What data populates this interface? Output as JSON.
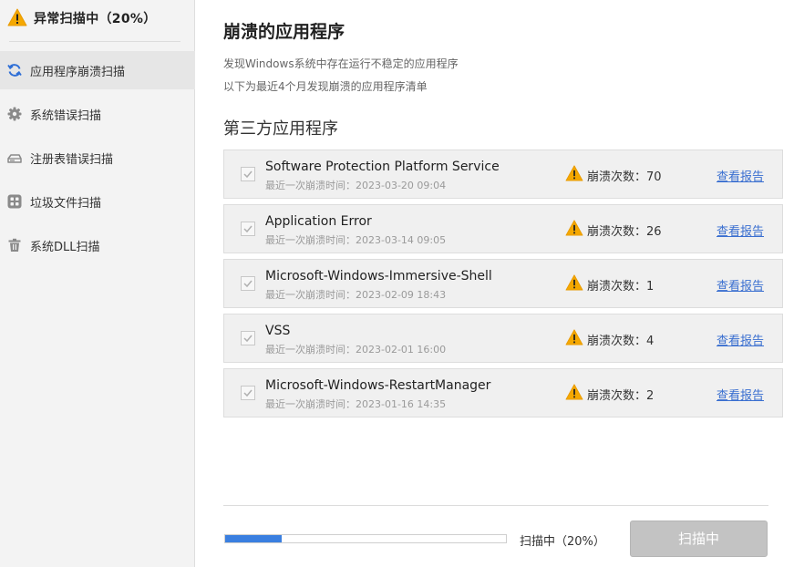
{
  "sidebar": {
    "header": {
      "title": "异常扫描中（20%）",
      "icon": "warning-icon"
    },
    "items": [
      {
        "label": "应用程序崩溃扫描",
        "icon": "refresh-icon",
        "active": true
      },
      {
        "label": "系统错误扫描",
        "icon": "gear-icon",
        "active": false
      },
      {
        "label": "注册表错误扫描",
        "icon": "registry-icon",
        "active": false
      },
      {
        "label": "垃圾文件扫描",
        "icon": "grid-icon",
        "active": false
      },
      {
        "label": "系统DLL扫描",
        "icon": "trash-icon",
        "active": false
      }
    ]
  },
  "main": {
    "title": "崩溃的应用程序",
    "desc1": "发现Windows系统中存在运行不稳定的应用程序",
    "desc2": "以下为最近4个月发现崩溃的应用程序清单",
    "section_title": "第三方应用程序",
    "apps": [
      {
        "name": "Software Protection Platform Service",
        "time": "最近一次崩溃时间：2023-03-20 09:04",
        "count": "崩溃次数：70",
        "report": "查看报告",
        "checked": true
      },
      {
        "name": "Application Error",
        "time": "最近一次崩溃时间：2023-03-14 09:05",
        "count": "崩溃次数：26",
        "report": "查看报告",
        "checked": true
      },
      {
        "name": "Microsoft-Windows-Immersive-Shell",
        "time": "最近一次崩溃时间：2023-02-09 18:43",
        "count": "崩溃次数：1",
        "report": "查看报告",
        "checked": true
      },
      {
        "name": "VSS",
        "time": "最近一次崩溃时间：2023-02-01 16:00",
        "count": "崩溃次数：4",
        "report": "查看报告",
        "checked": true
      },
      {
        "name": "Microsoft-Windows-RestartManager",
        "time": "最近一次崩溃时间：2023-01-16 14:35",
        "count": "崩溃次数：2",
        "report": "查看报告",
        "checked": true
      }
    ]
  },
  "footer": {
    "progress_percent": 20,
    "progress_text": "扫描中（20%）",
    "scan_button": "扫描中"
  },
  "colors": {
    "accent": "#3a7fe0",
    "warning": "#f5a800",
    "link": "#3a6fd0",
    "sidebar_bg": "#f3f3f3",
    "active_item_bg": "#e6e6e6",
    "row_bg": "#f0f0f0",
    "button_disabled": "#c3c3c3"
  }
}
